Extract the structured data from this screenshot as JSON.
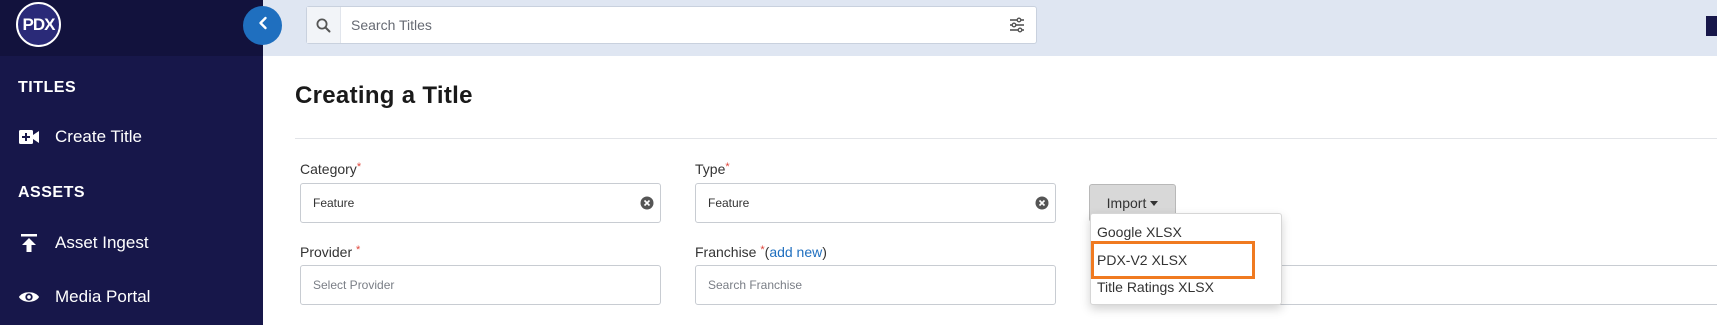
{
  "app": {
    "logo_text": "PDX"
  },
  "sidebar": {
    "sections": [
      {
        "title": "TITLES",
        "items": [
          {
            "label": "Create Title",
            "icon": "video-add-icon"
          }
        ]
      },
      {
        "title": "ASSETS",
        "items": [
          {
            "label": "Asset Ingest",
            "icon": "upload-icon"
          },
          {
            "label": "Media Portal",
            "icon": "eye-icon"
          }
        ]
      }
    ]
  },
  "search": {
    "placeholder": "Search Titles",
    "value": ""
  },
  "page": {
    "title": "Creating a Title"
  },
  "form": {
    "category": {
      "label": "Category",
      "required_mark": "*",
      "value": "Feature"
    },
    "type": {
      "label": "Type",
      "required_mark": "*",
      "value": "Feature"
    },
    "provider": {
      "label": "Provider",
      "required_mark": "*",
      "placeholder": "Select Provider"
    },
    "franchise": {
      "label": "Franchise",
      "required_mark": "*",
      "add_prefix": "(",
      "add_link": "add new",
      "add_suffix": ")",
      "placeholder": "Search Franchise"
    }
  },
  "import": {
    "label": "Import",
    "options": [
      "Google XLSX",
      "PDX-V2 XLSX",
      "Title Ratings XLSX"
    ],
    "highlighted": "PDX-V2 XLSX"
  },
  "colors": {
    "sidebar": "#17174a",
    "accent": "#1f6fbf",
    "highlight": "#f07a20",
    "required": "#e0453a"
  }
}
